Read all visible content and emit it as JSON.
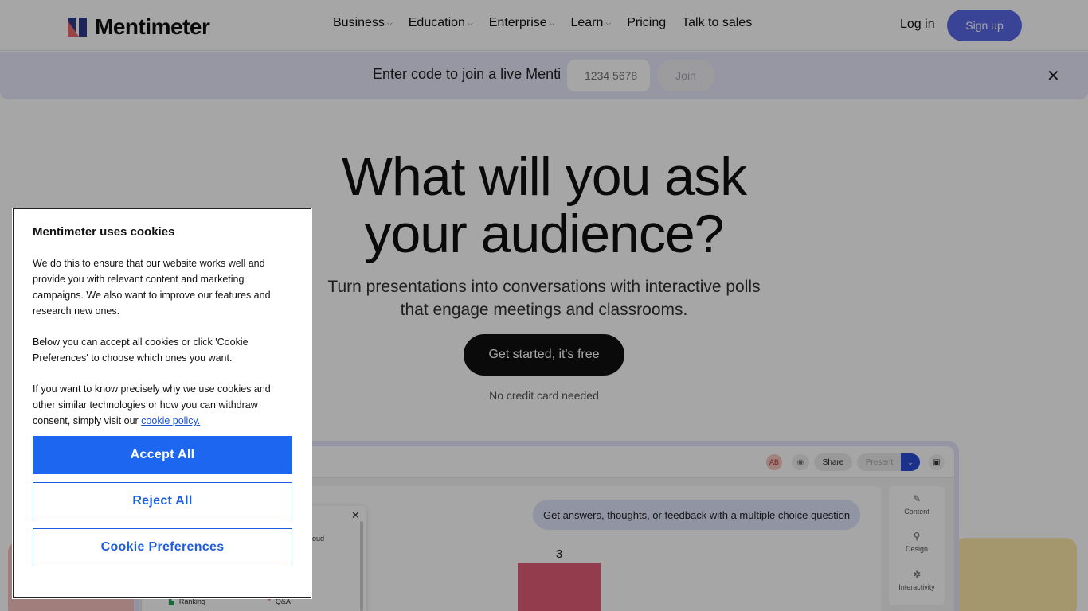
{
  "header": {
    "logo_text": "Mentimeter",
    "nav": [
      {
        "label": "Business",
        "has_menu": true
      },
      {
        "label": "Education",
        "has_menu": true
      },
      {
        "label": "Enterprise",
        "has_menu": true
      },
      {
        "label": "Learn",
        "has_menu": true
      },
      {
        "label": "Pricing",
        "has_menu": false
      },
      {
        "label": "Talk to sales",
        "has_menu": false
      }
    ],
    "login": "Log in",
    "signup": "Sign up"
  },
  "joinbar": {
    "text": "Enter code to join a live Menti",
    "placeholder": "1234 5678",
    "join": "Join",
    "close_icon": "close-icon"
  },
  "hero": {
    "title_line1": "What will you ask",
    "title_line2": "your audience?",
    "subtitle_line1": "Turn presentations into conversations with interactive polls",
    "subtitle_line2": "that engage meetings and classrooms.",
    "cta": "Get started, it's free",
    "note": "No credit card needed"
  },
  "mock": {
    "avatar": "AB",
    "share": "Share",
    "present": "Present",
    "question": "Get answers, thoughts, or feedback with a multiple choice question",
    "bar_value": "3",
    "side": [
      "Content",
      "Design",
      "Interactivity"
    ],
    "popover_items": [
      "oud",
      "Ranking",
      "Q&A"
    ]
  },
  "cookie": {
    "title": "Mentimeter uses cookies",
    "p1": "We do this to ensure that our website works well and provide you with relevant content and marketing campaigns. We also want to improve our features and research new ones.",
    "p2": "Below you can accept all cookies or click 'Cookie Preferences' to choose which ones you want.",
    "p3": "If you want to know precisely why we use cookies and other similar technologies or how you can withdraw consent, simply visit our",
    "link": "cookie policy.",
    "accept": "Accept All",
    "reject": "Reject All",
    "prefs": "Cookie Preferences"
  },
  "colors": {
    "brand_blue": "#5969e9",
    "accept_blue": "#1d66f0",
    "bar_pink": "#e05d78"
  }
}
